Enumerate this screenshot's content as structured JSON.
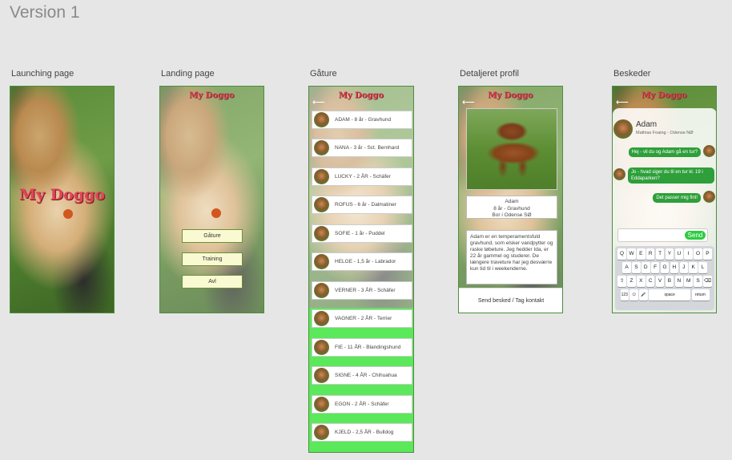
{
  "version_title": "Version 1",
  "screens": {
    "launching": {
      "label": "Launching page",
      "logo": "My Doggo"
    },
    "landing": {
      "label": "Landing page",
      "logo": "My Doggo",
      "buttons": [
        "Gåture",
        "Training",
        "Avl"
      ]
    },
    "gature": {
      "label": "Gåture",
      "logo": "My Doggo",
      "back_icon": "arrow-left-icon",
      "dogs": [
        "ADAM - 8 år - Gravhund",
        "NANA - 3 år - Sct. Bernhard",
        "LUCKY - 2 ÅR - Schäfer",
        "ROFUS - 6 år - Dalmatiner",
        "SOFIE - 1 år - Puddel",
        "HELGE - 1,5 år - Labrador",
        "VERNER - 3 ÅR - Schäfer",
        "VAGNER - 2 ÅR - Terrier",
        "FIE - 11 ÅR - Blandingshund",
        "SIGNE - 4 ÅR - Chihuahua",
        "EGON - 2 ÅR - Schäfer",
        "KJELD - 2,5 ÅR - Bulldog"
      ],
      "list_bg": "#5be85b"
    },
    "profile": {
      "label": "Detaljeret profil",
      "logo": "My Doggo",
      "back_icon": "arrow-left-icon",
      "name": "Adam",
      "age_breed": "8 år - Gravhund",
      "location": "Bor i Odense SØ",
      "about": "Adam er en temperamentsfuld gravhund, som elsker vandpytter og raske løbeture. Jeg hedder Ida, er 22 år gammel og studerer. De længere traveture har jeg desværre kun tid til i weekenderne.",
      "contact": "Send besked / Tag kontakt"
    },
    "messages": {
      "label": "Beskeder",
      "logo": "My Doggo",
      "back_icon": "arrow-left-icon",
      "contact_name": "Adam",
      "contact_sub": "Mathias Foaing - Odense NØ",
      "chat": [
        {
          "from": "me",
          "text": "Hej - vil du og Adam gå en tur?"
        },
        {
          "from": "them",
          "text": "Jo - hvad siger du til en tur kl. 19 i Eddaparken?"
        },
        {
          "from": "me",
          "text": "Det passer mig fint!"
        }
      ],
      "send_label": "Send",
      "keyboard": {
        "row1": [
          "Q",
          "W",
          "E",
          "R",
          "T",
          "Y",
          "U",
          "I",
          "O",
          "P"
        ],
        "row2": [
          "A",
          "S",
          "D",
          "F",
          "G",
          "H",
          "J",
          "K",
          "L"
        ],
        "row3": [
          "⇧",
          "Z",
          "X",
          "C",
          "V",
          "B",
          "N",
          "M",
          "S",
          "⌫"
        ],
        "num": "123",
        "emoji": "☺",
        "mic": "🎤",
        "space": "space",
        "return": "return"
      },
      "bubble_color": "#2e9f3a"
    }
  }
}
